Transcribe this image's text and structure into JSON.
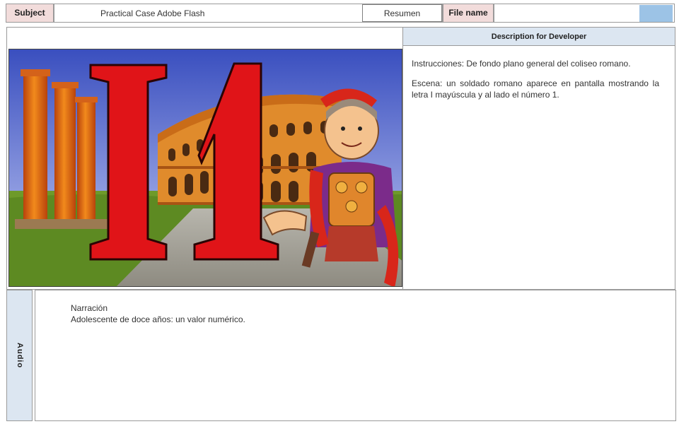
{
  "header": {
    "subject_label": "Subject",
    "subject_value": "Practical Case Adobe Flash",
    "resumen_button": "Resumen",
    "file_name_label": "File name",
    "file_name_value": ""
  },
  "illustration": {
    "letter": "I",
    "number": "1"
  },
  "description": {
    "header": "Description for Developer",
    "instructions": "Instrucciones: De fondo plano general del coliseo romano.",
    "scene": "Escena: un soldado romano aparece en pantalla mostrando la letra I  mayúscula y al lado el número 1."
  },
  "audio": {
    "label": "Audio",
    "narration_title": "Narración",
    "narration_text": "Adolescente de doce años: un valor numérico."
  }
}
